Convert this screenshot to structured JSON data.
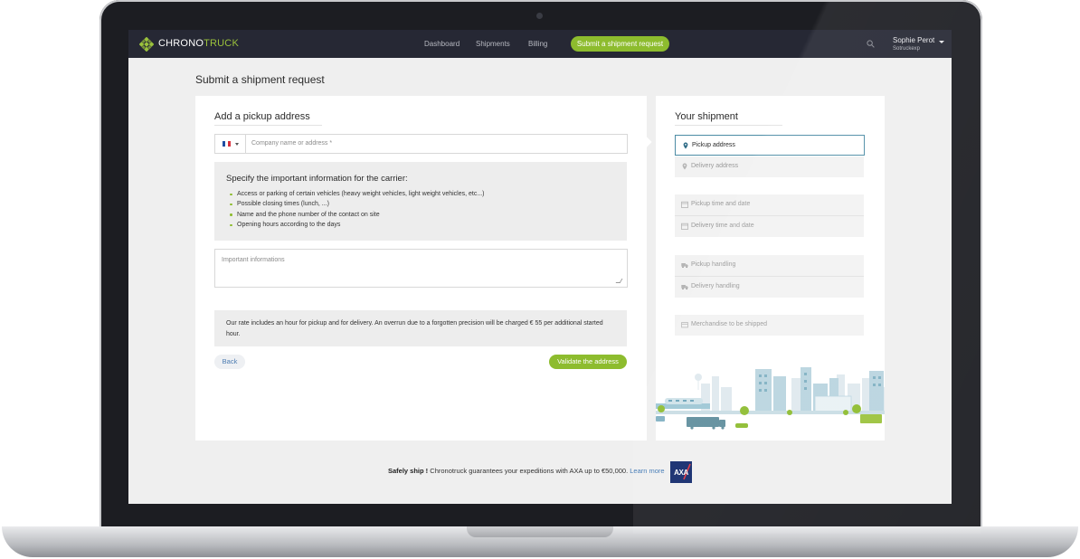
{
  "nav": {
    "logo_primary": "CHRONO",
    "logo_secondary": "TRUCK",
    "links": [
      "Dashboard",
      "Shipments",
      "Billing"
    ],
    "cta": "Submit a shipment request",
    "user_name": "Sophie Perot",
    "user_company": "Sotruckexp"
  },
  "page": {
    "title": "Submit a shipment request"
  },
  "pickup": {
    "title": "Add a pickup address",
    "address_placeholder": "Company name or address *",
    "info_title": "Specify the important information for the carrier:",
    "info_items": [
      "Access or parking of certain vehicles (heavy weight vehicles, light weight vehicles, etc...)",
      "Possible closing times (lunch, ...)",
      "Name and the phone number of the contact on site",
      "Opening hours according to the days"
    ],
    "important_placeholder": "Important informations",
    "rate_notice": "Our rate includes an hour for pickup and for delivery. An overrun due to a forgotten precision will be charged € 55 per additional started hour.",
    "back": "Back",
    "validate": "Validate the address"
  },
  "shipment": {
    "title": "Your shipment",
    "fields": [
      {
        "label": "Pickup address",
        "icon": "pin-icon",
        "active": true
      },
      {
        "label": "Delivery address",
        "icon": "pin-icon",
        "active": false
      },
      {
        "label": "Pickup time and date",
        "icon": "calendar-icon",
        "active": false
      },
      {
        "label": "Delivery time and date",
        "icon": "calendar-icon",
        "active": false
      },
      {
        "label": "Pickup handling",
        "icon": "truck-icon",
        "active": false
      },
      {
        "label": "Delivery handling",
        "icon": "truck-icon",
        "active": false
      },
      {
        "label": "Merchandise to be shipped",
        "icon": "box-icon",
        "active": false
      }
    ]
  },
  "footer": {
    "bold": "Safely ship !",
    "text": " Chronotruck guarantees your expeditions with AXA up to €50,000. ",
    "link": "Learn more",
    "badge": "AXA"
  },
  "colors": {
    "accent": "#8dbc2e",
    "nav_bg": "#262834",
    "link": "#3d76b3",
    "active_border": "#4c8ca5"
  }
}
